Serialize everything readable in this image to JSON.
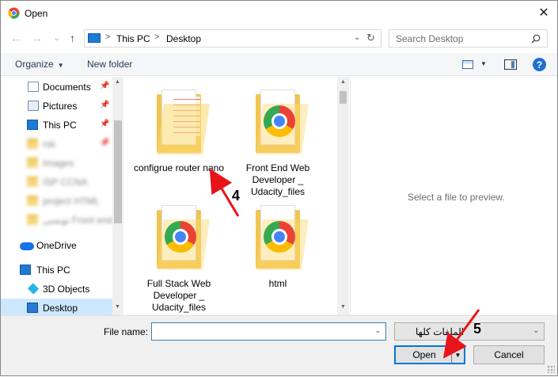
{
  "window": {
    "title": "Open",
    "close_label": "✕"
  },
  "nav": {
    "back": "←",
    "forward": "→",
    "recent": "⌄",
    "up": "↑",
    "breadcrumbs": [
      "This PC",
      "Desktop"
    ],
    "search_placeholder": "Search Desktop"
  },
  "toolbar": {
    "organize": "Organize",
    "new_folder": "New folder",
    "help": "?"
  },
  "sidebar": {
    "items": [
      {
        "label": "Documents",
        "icon": "documents-icon",
        "pinned": true
      },
      {
        "label": "Pictures",
        "icon": "pictures-icon",
        "pinned": true
      },
      {
        "label": "This PC",
        "icon": "this-pc-icon",
        "pinned": true
      },
      {
        "label": "rsk",
        "icon": "folder-icon",
        "pinned": true,
        "blurred": true
      },
      {
        "label": "Images",
        "icon": "folder-icon",
        "blurred": true
      },
      {
        "label": "ISP CCNA",
        "icon": "folder-icon",
        "blurred": true
      },
      {
        "label": "project HTML",
        "icon": "folder-icon",
        "blurred": true
      },
      {
        "label": "تونسی Front end",
        "icon": "folder-icon",
        "blurred": true
      },
      {
        "label": "OneDrive",
        "icon": "onedrive-icon"
      },
      {
        "label": "This PC",
        "icon": "this-pc-icon"
      },
      {
        "label": "3D Objects",
        "icon": "3d-objects-icon"
      },
      {
        "label": "Desktop",
        "icon": "desktop-icon",
        "selected": true
      }
    ]
  },
  "files": [
    {
      "name": "configrue router nano",
      "kind": "document-folder"
    },
    {
      "name": "Front End Web Developer _ Udacity_files",
      "kind": "chrome-folder"
    },
    {
      "name": "Full Stack Web Developer _ Udacity_files",
      "kind": "chrome-folder"
    },
    {
      "name": "html",
      "kind": "chrome-folder"
    }
  ],
  "preview": {
    "message": "Select a file to preview."
  },
  "footer": {
    "file_name_label": "File name:",
    "file_name_value": "",
    "filter_value": "الملفات كلها",
    "open_label": "Open",
    "cancel_label": "Cancel"
  },
  "annotations": {
    "step4": "4",
    "step5": "5",
    "arrow_color": "#e8141a"
  }
}
